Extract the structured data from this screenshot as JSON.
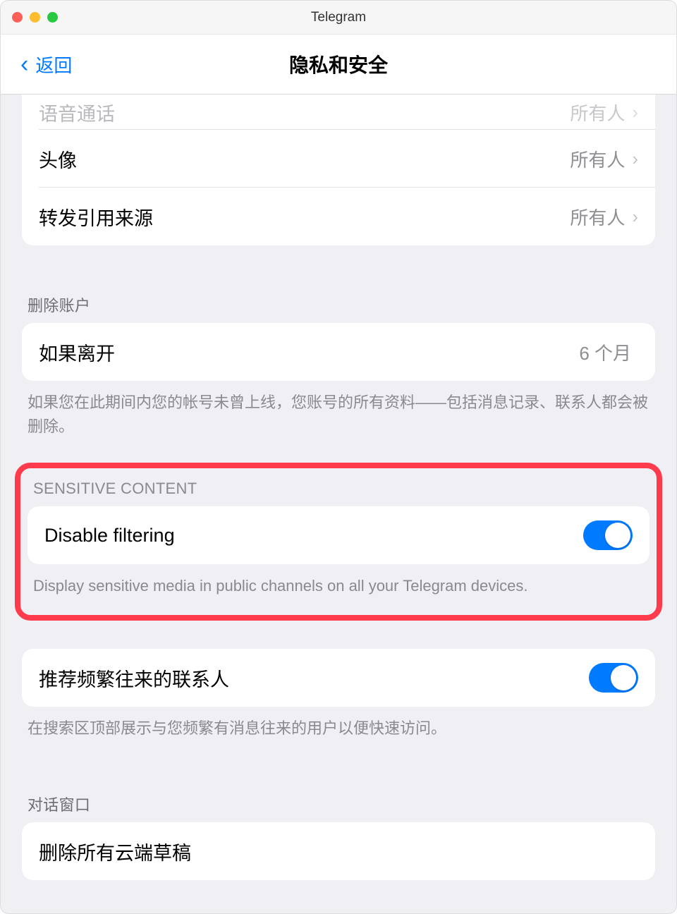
{
  "window": {
    "title": "Telegram"
  },
  "nav": {
    "back": "返回",
    "title": "隐私和安全"
  },
  "privacy_rows": {
    "voice_calls": {
      "label": "语音通话",
      "value": "所有人"
    },
    "avatar": {
      "label": "头像",
      "value": "所有人"
    },
    "forward": {
      "label": "转发引用来源",
      "value": "所有人"
    }
  },
  "delete_account": {
    "header": "删除账户",
    "row_label": "如果离开",
    "row_value": "6 个月",
    "footer": "如果您在此期间内您的帐号未曾上线，您账号的所有资料——包括消息记录、联系人都会被删除。"
  },
  "sensitive": {
    "header": "SENSITIVE CONTENT",
    "label": "Disable filtering",
    "footer": "Display sensitive media in public channels on all your Telegram devices."
  },
  "suggest": {
    "label": "推荐频繁往来的联系人",
    "footer": "在搜索区顶部展示与您频繁有消息往来的用户以便快速访问。"
  },
  "chat_window": {
    "header": "对话窗口",
    "label": "删除所有云端草稿"
  }
}
